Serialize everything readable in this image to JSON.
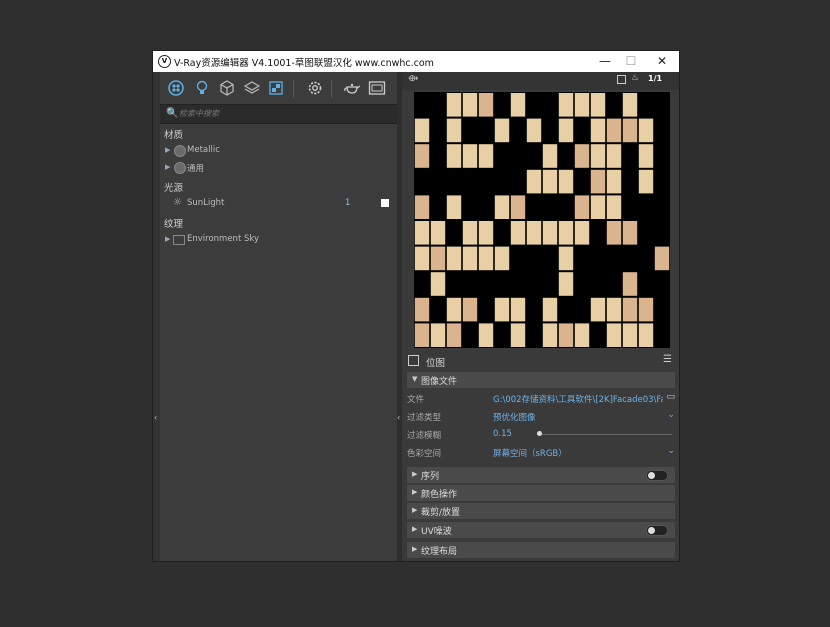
{
  "window": {
    "title": "V-Ray资源编辑器 V4.1001-草图联盟汉化 www.cnwhc.com",
    "logo_glyph": "V",
    "minimize": "—",
    "maximize": "☐",
    "close": "✕"
  },
  "toolbar": {
    "icons": [
      "all-assets-icon",
      "lights-icon",
      "geometry-icon",
      "layers-icon",
      "textures-icon",
      "settings-icon",
      "teapot-render-icon",
      "render-window-icon"
    ]
  },
  "search": {
    "placeholder": "检索中搜索",
    "icon": "🔍"
  },
  "tree": {
    "categories": {
      "materials": "材质",
      "lights": "光源",
      "textures": "纹理"
    },
    "materials": [
      {
        "label": "Metallic"
      },
      {
        "label": "通用"
      }
    ],
    "lights": [
      {
        "label": "SunLight",
        "count": "1"
      }
    ],
    "textures": [
      {
        "label": "Environment Sky"
      }
    ]
  },
  "preview": {
    "counter": "1/1",
    "tile_color_a": "#e8cfa6",
    "tile_color_b": "#d9b48f"
  },
  "properties": {
    "header": "位图",
    "sections": {
      "image_file": "图像文件",
      "sequence": "序列",
      "color_ops": "颜色操作",
      "crop_place": "裁剪/放置",
      "uv_noise": "UV噪波",
      "texture_layout": "纹理布局"
    },
    "file_label": "文件",
    "file_value": "G:\\002存储资料\\工具软件\\[2K]Facade03\\Fac...",
    "filter_type_label": "过滤类型",
    "filter_type_value": "预优化图像",
    "filter_blur_label": "过滤模糊",
    "filter_blur_value": "0.15",
    "color_space_label": "色彩空间",
    "color_space_value": "屏幕空间（sRGB）"
  },
  "colors": {
    "accent": "#6fb3e8",
    "panel": "#3a3a3a"
  }
}
